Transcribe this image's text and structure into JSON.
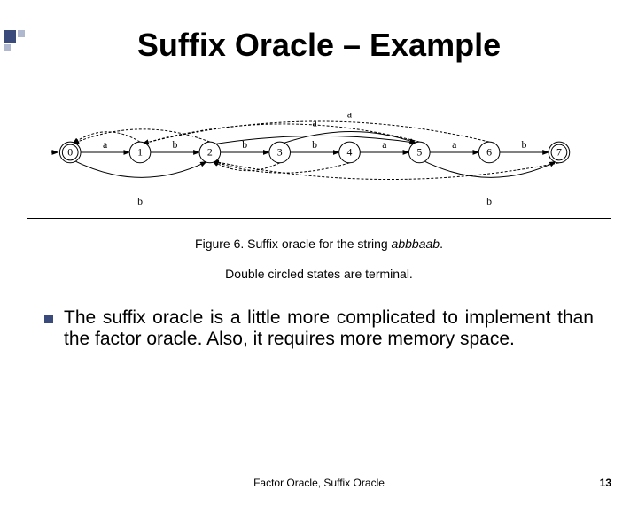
{
  "accent": {},
  "title": {
    "prefix": "Suffix Oracle – ",
    "bold": "Example"
  },
  "diagram": {
    "states": [
      {
        "id": 0,
        "label": "0",
        "terminal": true
      },
      {
        "id": 1,
        "label": "1",
        "terminal": false
      },
      {
        "id": 2,
        "label": "2",
        "terminal": false
      },
      {
        "id": 3,
        "label": "3",
        "terminal": false
      },
      {
        "id": 4,
        "label": "4",
        "terminal": false
      },
      {
        "id": 5,
        "label": "5",
        "terminal": false
      },
      {
        "id": 6,
        "label": "6",
        "terminal": false
      },
      {
        "id": 7,
        "label": "7",
        "terminal": true
      }
    ],
    "forward_edges": [
      {
        "from": 0,
        "to": 1,
        "label": "a"
      },
      {
        "from": 1,
        "to": 2,
        "label": "b"
      },
      {
        "from": 2,
        "to": 3,
        "label": "b"
      },
      {
        "from": 3,
        "to": 4,
        "label": "b"
      },
      {
        "from": 4,
        "to": 5,
        "label": "a"
      },
      {
        "from": 5,
        "to": 6,
        "label": "a"
      },
      {
        "from": 6,
        "to": 7,
        "label": "b"
      }
    ],
    "upper_arcs": [
      {
        "from": 2,
        "to": 5,
        "label": "a",
        "height": 28
      },
      {
        "from": 3,
        "to": 5,
        "label": "a",
        "height": 38
      },
      {
        "from": 0,
        "to": 2,
        "label": "b",
        "height": 48,
        "below": true
      },
      {
        "from": 5,
        "to": 7,
        "label": "b",
        "height": 48,
        "below": true
      }
    ],
    "top_dashed": [
      {
        "from": 1,
        "to": 0
      },
      {
        "from": 2,
        "to": 0
      },
      {
        "from": 6,
        "to": 1
      },
      {
        "from": 5,
        "to": 1
      }
    ],
    "bottom_dashed": [
      {
        "from": 3,
        "to": 2
      },
      {
        "from": 4,
        "to": 2
      },
      {
        "from": 7,
        "to": 2
      }
    ]
  },
  "caption": {
    "prefix": "Figure 6. Suffix oracle for the string ",
    "string": "abbbaab",
    "suffix": "."
  },
  "note": "Double circled states are terminal.",
  "body": "The suffix oracle is a little more complicated to implement than the factor oracle. Also, it requires more memory space.",
  "footer": "Factor Oracle, Suffix Oracle",
  "page": "13"
}
